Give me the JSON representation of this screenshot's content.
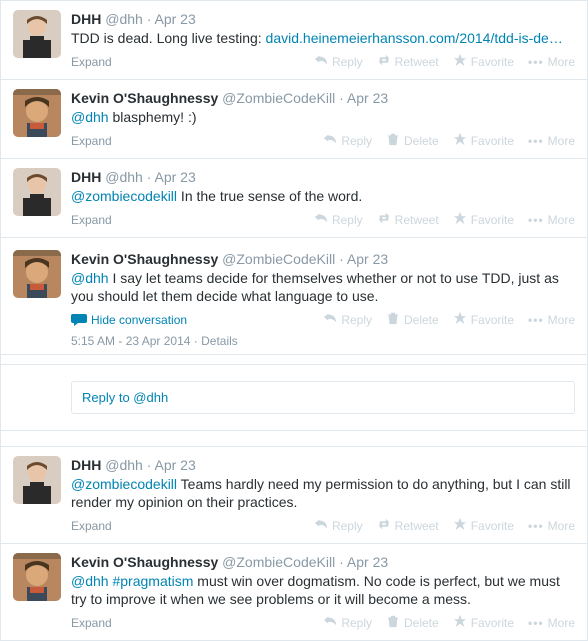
{
  "labels": {
    "expand": "Expand",
    "hide": "Hide conversation",
    "reply": "Reply",
    "retweet": "Retweet",
    "delete": "Delete",
    "favorite": "Favorite",
    "more": "More",
    "details": "Details",
    "dot": "·"
  },
  "reply_box": {
    "placeholder": "Reply to @dhh"
  },
  "tweets": [
    {
      "fullname": "DHH",
      "username": "@dhh",
      "time": "Apr 23",
      "text_pre": "TDD is dead. Long live testing: ",
      "link": "david.heinemeierhansson.com/2014/tdd-is-de…",
      "actions": [
        "reply",
        "retweet",
        "favorite",
        "more"
      ],
      "avatar": "dhh"
    },
    {
      "fullname": "Kevin O'Shaughnessy",
      "username": "@ZombieCodeKill",
      "time": "Apr 23",
      "mention": "@dhh",
      "text_post": " blasphemy! :)",
      "actions": [
        "reply",
        "delete",
        "favorite",
        "more"
      ],
      "avatar": "kevin"
    },
    {
      "fullname": "DHH",
      "username": "@dhh",
      "time": "Apr 23",
      "mention": "@zombiecodekill",
      "text_post": " In the true sense of the word.",
      "actions": [
        "reply",
        "retweet",
        "favorite",
        "more"
      ],
      "avatar": "dhh"
    },
    {
      "fullname": "Kevin O'Shaughnessy",
      "username": "@ZombieCodeKill",
      "time": "Apr 23",
      "mention": "@dhh",
      "text_post": " I say let teams decide for themselves whether or not to use TDD, just as you should let them decide what language to use.",
      "actions": [
        "reply",
        "delete",
        "favorite",
        "more"
      ],
      "avatar": "kevin",
      "expanded": true,
      "timestamp": "5:15 AM - 23 Apr 2014"
    },
    {
      "fullname": "DHH",
      "username": "@dhh",
      "time": "Apr 23",
      "mention": "@zombiecodekill",
      "text_post": " Teams hardly need my permission to do anything, but I can still render my opinion on their practices.",
      "actions": [
        "reply",
        "retweet",
        "favorite",
        "more"
      ],
      "avatar": "dhh"
    },
    {
      "fullname": "Kevin O'Shaughnessy",
      "username": "@ZombieCodeKill",
      "time": "Apr 23",
      "mention": "@dhh",
      "hashtag": "#pragmatism",
      "text_post": " must win over dogmatism. No code is perfect, but we must try to improve it when we see problems or it will become a mess.",
      "actions": [
        "reply",
        "delete",
        "favorite",
        "more"
      ],
      "avatar": "kevin"
    }
  ]
}
